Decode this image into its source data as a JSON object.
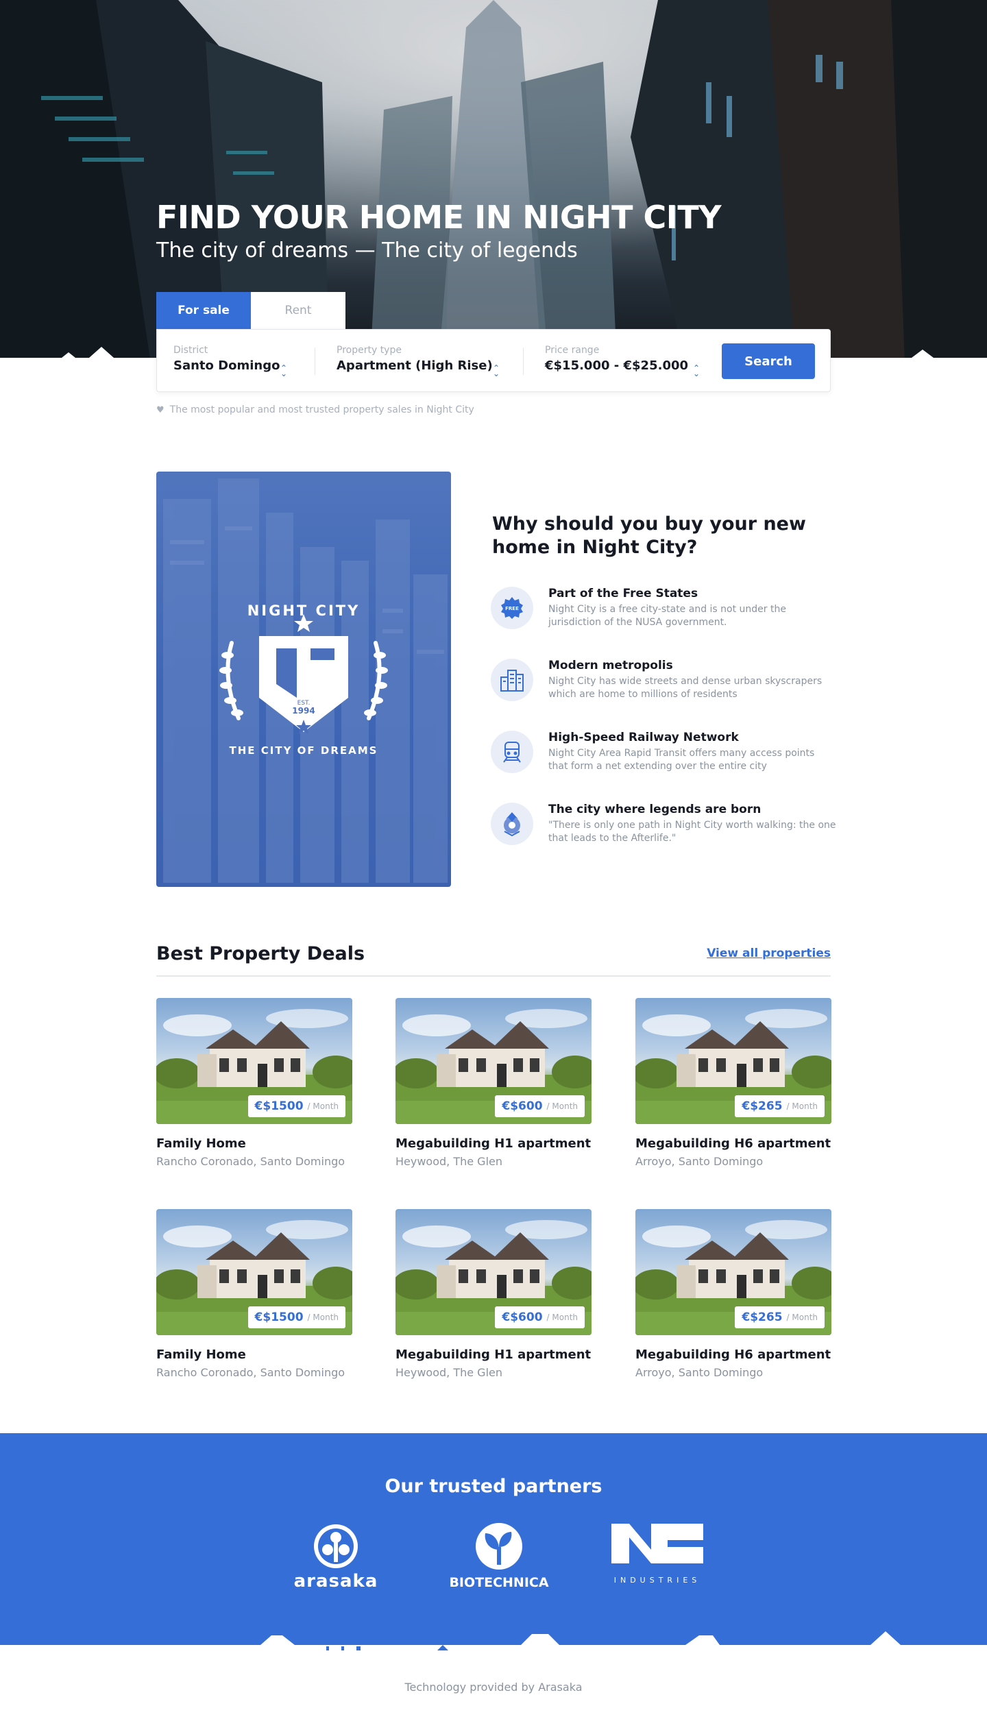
{
  "hero": {
    "title": "FIND YOUR HOME IN NIGHT CITY",
    "subtitle": "The city of dreams — The city of legends"
  },
  "search": {
    "tabs": [
      {
        "label": "For sale",
        "active": true
      },
      {
        "label": "Rent",
        "active": false
      }
    ],
    "district": {
      "label": "District",
      "value": "Santo Domingo"
    },
    "property_type": {
      "label": "Property type",
      "value": "Apartment (High Rise)"
    },
    "price_range": {
      "label": "Price range",
      "value": "€$15.000 - €$25.000"
    },
    "button": "Search",
    "note": "The most popular and most trusted property sales in Night City",
    "note_icon": "heart-icon"
  },
  "why": {
    "emblem": {
      "top": "NIGHT CITY",
      "est": "EST.",
      "year": "1994",
      "bottom": "THE CITY OF DREAMS"
    },
    "title": "Why should you buy your new home in Night City?",
    "features": [
      {
        "icon": "free-badge-icon",
        "icon_text": "FREE",
        "title": "Part of the Free States",
        "desc": "Night City is a free city-state  and is not under the jurisdiction of the NUSA government."
      },
      {
        "icon": "city-buildings-icon",
        "title": "Modern metropolis",
        "desc": "Night City has wide streets and dense urban skyscrapers which are home to millions of residents"
      },
      {
        "icon": "train-icon",
        "title": "High-Speed Railway Network",
        "desc": "Night City Area Rapid Transit offers many access points that form a net extending over the entire city"
      },
      {
        "icon": "legend-emblem-icon",
        "title": "The city where legends are born",
        "desc": "\"There is only one path in Night City worth walking: the one that leads to the Afterlife.\""
      }
    ]
  },
  "deals": {
    "title": "Best Property Deals",
    "view_all": "View all properties",
    "per": "/ Month",
    "cards": [
      {
        "name": "Family Home",
        "location": "Rancho Coronado, Santo Domingo",
        "price": "€$1500"
      },
      {
        "name": "Megabuilding H1 apartment",
        "location": "Heywood, The Glen",
        "price": "€$600"
      },
      {
        "name": "Megabuilding H6 apartment",
        "location": "Arroyo, Santo Domingo",
        "price": "€$265"
      },
      {
        "name": "Family Home",
        "location": "Rancho Coronado, Santo Domingo",
        "price": "€$1500"
      },
      {
        "name": "Megabuilding H1 apartment",
        "location": "Heywood, The Glen",
        "price": "€$600"
      },
      {
        "name": "Megabuilding H6 apartment",
        "location": "Arroyo, Santo Domingo",
        "price": "€$265"
      }
    ]
  },
  "partners": {
    "title": "Our trusted partners",
    "logos": [
      {
        "name": "arasaka",
        "text": "arasaka"
      },
      {
        "name": "biotechnica",
        "text": "BIOTECHNICA"
      },
      {
        "name": "nc-industries",
        "text": "INDUSTRIES"
      }
    ]
  },
  "footer": {
    "text": "Technology provided by Arasaka"
  },
  "colors": {
    "accent": "#356ed6",
    "text": "#161a24",
    "muted": "#8a93a0"
  }
}
